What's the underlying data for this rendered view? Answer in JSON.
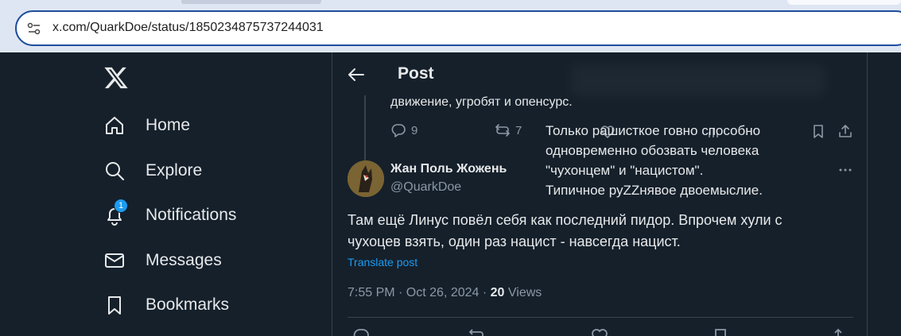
{
  "browser": {
    "url": "x.com/QuarkDoe/status/1850234875737244031"
  },
  "nav": {
    "items": [
      {
        "label": "Home"
      },
      {
        "label": "Explore"
      },
      {
        "label": "Notifications",
        "badge": "1"
      },
      {
        "label": "Messages"
      },
      {
        "label": "Bookmarks"
      }
    ]
  },
  "header": {
    "title": "Post"
  },
  "previous_post": {
    "text_tail": "движение, угробят и опенсурс.",
    "replies": "9",
    "reposts": "7"
  },
  "overlay_note": {
    "lines": [
      "Только рашисткое говно способно",
      "одновременно обозвать человека",
      "\"чухонцем\" и \"нацистом\".",
      "Типичное руZZнявое двоемыслие."
    ]
  },
  "post": {
    "display_name": "Жан Поль Жожень",
    "handle": "@QuarkDoe",
    "text_line1": "Там ещё Линус повёл себя как последний пидор. Впрочем хули с",
    "text_line2": "чухоцев взять, один раз нацист - навсегда нацист.",
    "translate_label": "Translate post",
    "timestamp": "7:55 PM · Oct 26, 2024 · ",
    "views_count": "20",
    "views_label": " Views"
  },
  "colors": {
    "background": "#15202b",
    "accent": "#1d9bf0",
    "secondary_text": "#8b98a5"
  }
}
